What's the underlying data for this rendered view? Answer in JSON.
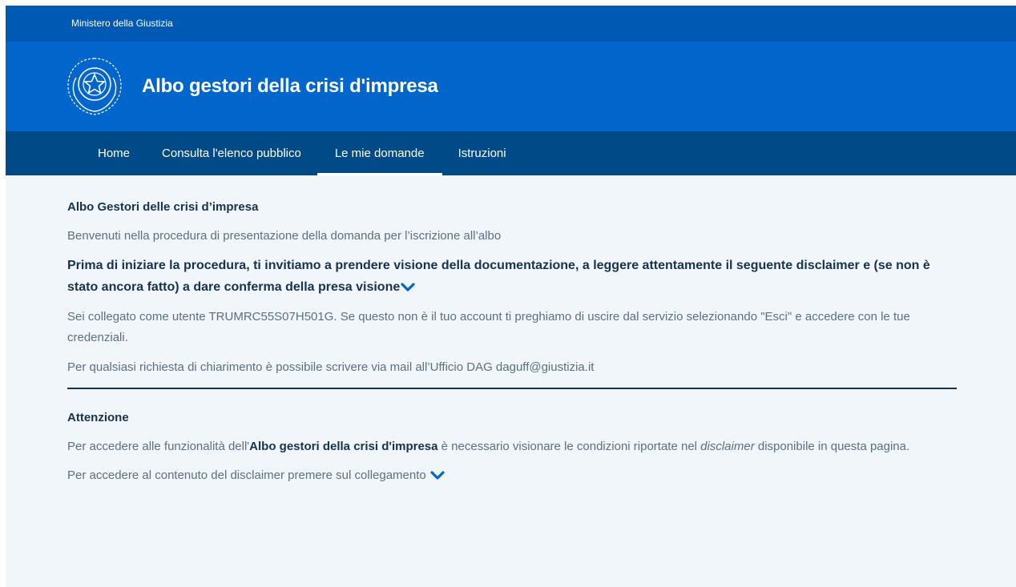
{
  "slim_header": {
    "label": "Ministero della Giustizia"
  },
  "header": {
    "title": "Albo gestori della crisi d'impresa",
    "logo_icon": "italian-republic-emblem-icon"
  },
  "nav": {
    "items": [
      {
        "label": "Home"
      },
      {
        "label": "Consulta l'elenco pubblico"
      },
      {
        "label": "Le mie domande",
        "active": true
      },
      {
        "label": "Istruzioni"
      }
    ]
  },
  "content": {
    "section_title": "Albo Gestori delle crisi d’impresa",
    "intro": "Benvenuti nella procedura di presentazione della domanda per l’iscrizione all’albo",
    "bold_notice": "Prima di iniziare la procedura, ti invitiamo a prendere visione della documentazione, a leggere attentamente il seguente disclaimer e (se non è stato ancora fatto) a dare conferma della presa visione",
    "user_msg": "Sei collegato come utente TRUMRC55S07H501G. Se questo non è il tuo account ti preghiamo di uscire dal servizio selezionando \"Esci\" e accedere con le tue credenziali.",
    "contact": "Per qualsiasi richiesta di chiarimento è possibile scrivere via mail all’Ufficio DAG daguff@giustizia.it"
  },
  "attention": {
    "title": "Attenzione",
    "text_before": "Per accedere alle funzionalità dell'",
    "text_bold": "Albo gestori della crisi d'impresa",
    "text_middle": " è necessario visionare le condizioni riportate nel ",
    "text_italic": "disclaimer",
    "text_after": " disponibile in questa pagina.",
    "link_text": "Per accedere al contenuto del disclaimer premere sul collegamento "
  },
  "colors": {
    "slim": "#0059b3",
    "header": "#0066cc",
    "nav": "#004a87",
    "background": "#f1f6fa",
    "link": "#0066cc"
  }
}
